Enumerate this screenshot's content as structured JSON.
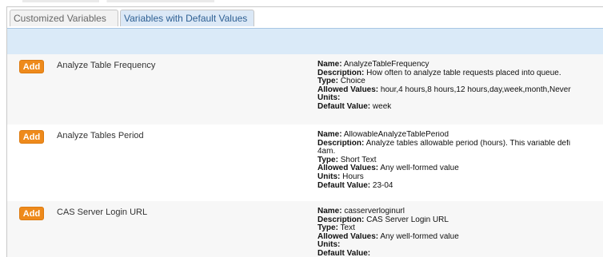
{
  "tabs": [
    {
      "label": "Customized Variables"
    },
    {
      "label": "Variables with Default Values"
    }
  ],
  "add_label": "Add",
  "field_labels": {
    "name": "Name:",
    "description": "Description:",
    "type": "Type:",
    "allowed": "Allowed Values:",
    "units": "Units:",
    "default": "Default Value:"
  },
  "variables": [
    {
      "title": "Analyze Table Frequency",
      "name": "AnalyzeTableFrequency",
      "description": "How often to analyze table requests placed into queue.",
      "description_cont": "",
      "type": "Choice",
      "allowed": "hour,4 hours,8 hours,12 hours,day,week,month,Never",
      "units": "",
      "default": "week"
    },
    {
      "title": "Analyze Tables Period",
      "name": "AllowableAnalyzeTablePeriod",
      "description": "Analyze tables allowable period (hours). This variable defi",
      "description_cont": "4am.",
      "type": "Short Text",
      "allowed": "Any well-formed value",
      "units": "Hours",
      "default": "23-04"
    },
    {
      "title": "CAS Server Login URL",
      "name": "casserverloginurl",
      "description": "CAS Server Login URL",
      "description_cont": "",
      "type": "Text",
      "allowed": "Any well-formed value",
      "units": "",
      "default": ""
    }
  ]
}
